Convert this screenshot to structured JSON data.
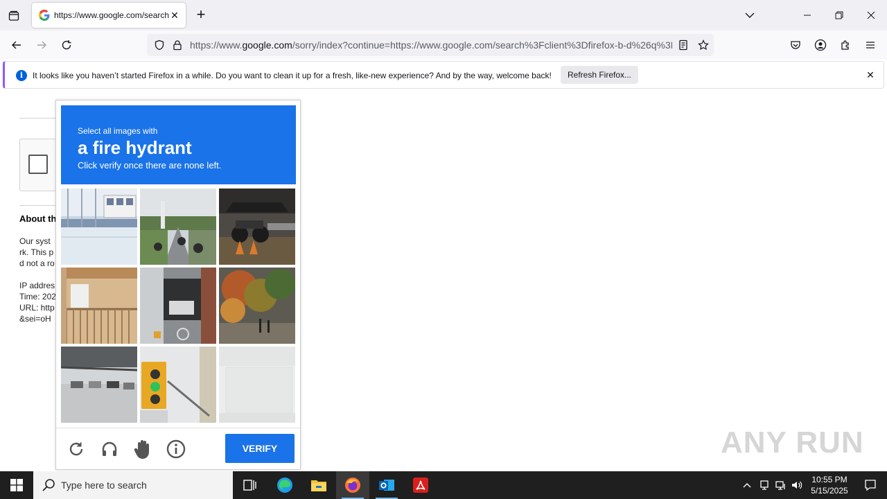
{
  "browser": {
    "tab": {
      "favicon": "G",
      "title": "https://www.google.com/search?client=firefox-b-d&q="
    },
    "url": {
      "prefix": "https://www.",
      "domain": "google.com",
      "rest": "/sorry/index?continue=https://www.google.com/search%3Fclient%3Dfirefox-b-d%26q%3D"
    },
    "notification": {
      "message": "It looks like you haven’t started Firefox in a while. Do you want to clean it up for a fresh, like-new experience? And by the way, welcome back!",
      "button_label": "Refresh Firefox..."
    }
  },
  "background_page": {
    "heading": "About th",
    "paragraph": [
      "Our syst",
      "rk. This p",
      "d not a ro"
    ],
    "details": [
      "IP addres",
      "Time: 202",
      "URL: http",
      "&sei=oH"
    ]
  },
  "captcha": {
    "instruction_line1": "Select all images with",
    "target": "a fire hydrant",
    "instruction_line3": "Click verify once there are none left.",
    "verify_label": "VERIFY",
    "tiles": [
      {
        "name": "bus-station"
      },
      {
        "name": "motorcycles-road"
      },
      {
        "name": "motorcycle-car"
      },
      {
        "name": "balcony"
      },
      {
        "name": "bicycle-door"
      },
      {
        "name": "autumn-trees"
      },
      {
        "name": "parking-lot"
      },
      {
        "name": "traffic-light"
      },
      {
        "name": "faded-wall"
      }
    ],
    "tools": [
      "reload-icon",
      "headphones-icon",
      "hand-icon",
      "info-icon"
    ]
  },
  "watermark": "ANY RUN",
  "taskbar": {
    "search_placeholder": "Type here to search",
    "time": "10:55 PM",
    "date": "5/15/2025"
  }
}
